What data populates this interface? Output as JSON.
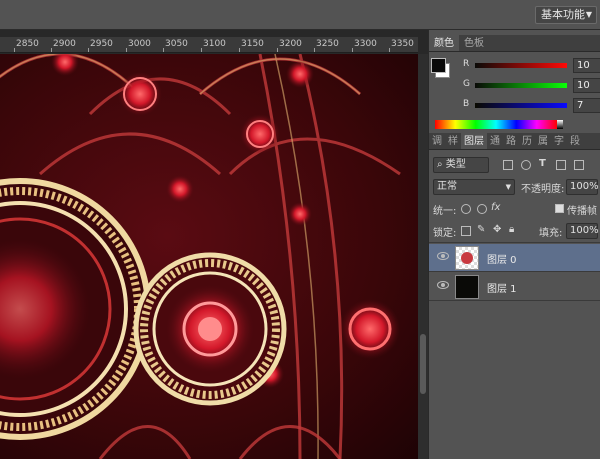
{
  "topbar": {
    "workspace": "基本功能"
  },
  "ruler": {
    "labels": [
      "2850",
      "2900",
      "2950",
      "3000",
      "3050",
      "3100",
      "3150",
      "3200",
      "3250",
      "3300",
      "3350"
    ]
  },
  "color_panel": {
    "tabs": [
      "颜色",
      "色板"
    ],
    "channels": [
      {
        "label": "R",
        "value": "10"
      },
      {
        "label": "G",
        "value": "10"
      },
      {
        "label": "B",
        "value": "7"
      }
    ],
    "foreground": "#0a0a07"
  },
  "layers_panel": {
    "tabs": [
      "调",
      "样",
      "图层",
      "通",
      "路",
      "历",
      "属",
      "字",
      "段"
    ],
    "kind": "类型",
    "blend_mode": "正常",
    "opacity_label": "不透明度:",
    "opacity": "100%",
    "unify_label": "统一:",
    "propagate_label": "传播帧",
    "lock_label": "锁定:",
    "fill_label": "填充:",
    "fill": "100%",
    "layers": [
      {
        "name": "图层 0",
        "selected": true
      },
      {
        "name": "图层 1",
        "selected": false
      }
    ]
  }
}
